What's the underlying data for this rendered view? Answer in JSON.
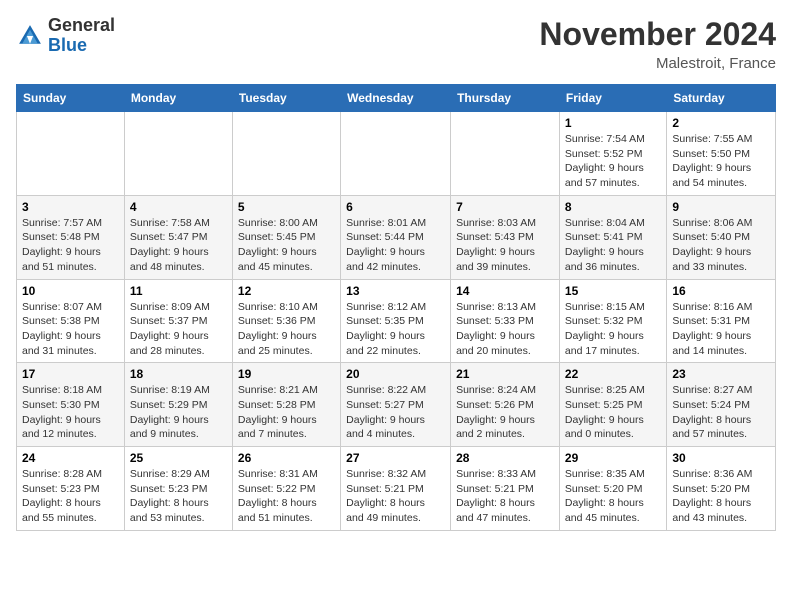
{
  "logo": {
    "text_general": "General",
    "text_blue": "Blue"
  },
  "header": {
    "month": "November 2024",
    "location": "Malestroit, France"
  },
  "weekdays": [
    "Sunday",
    "Monday",
    "Tuesday",
    "Wednesday",
    "Thursday",
    "Friday",
    "Saturday"
  ],
  "weeks": [
    [
      {
        "day": "",
        "info": ""
      },
      {
        "day": "",
        "info": ""
      },
      {
        "day": "",
        "info": ""
      },
      {
        "day": "",
        "info": ""
      },
      {
        "day": "",
        "info": ""
      },
      {
        "day": "1",
        "info": "Sunrise: 7:54 AM\nSunset: 5:52 PM\nDaylight: 9 hours and 57 minutes."
      },
      {
        "day": "2",
        "info": "Sunrise: 7:55 AM\nSunset: 5:50 PM\nDaylight: 9 hours and 54 minutes."
      }
    ],
    [
      {
        "day": "3",
        "info": "Sunrise: 7:57 AM\nSunset: 5:48 PM\nDaylight: 9 hours and 51 minutes."
      },
      {
        "day": "4",
        "info": "Sunrise: 7:58 AM\nSunset: 5:47 PM\nDaylight: 9 hours and 48 minutes."
      },
      {
        "day": "5",
        "info": "Sunrise: 8:00 AM\nSunset: 5:45 PM\nDaylight: 9 hours and 45 minutes."
      },
      {
        "day": "6",
        "info": "Sunrise: 8:01 AM\nSunset: 5:44 PM\nDaylight: 9 hours and 42 minutes."
      },
      {
        "day": "7",
        "info": "Sunrise: 8:03 AM\nSunset: 5:43 PM\nDaylight: 9 hours and 39 minutes."
      },
      {
        "day": "8",
        "info": "Sunrise: 8:04 AM\nSunset: 5:41 PM\nDaylight: 9 hours and 36 minutes."
      },
      {
        "day": "9",
        "info": "Sunrise: 8:06 AM\nSunset: 5:40 PM\nDaylight: 9 hours and 33 minutes."
      }
    ],
    [
      {
        "day": "10",
        "info": "Sunrise: 8:07 AM\nSunset: 5:38 PM\nDaylight: 9 hours and 31 minutes."
      },
      {
        "day": "11",
        "info": "Sunrise: 8:09 AM\nSunset: 5:37 PM\nDaylight: 9 hours and 28 minutes."
      },
      {
        "day": "12",
        "info": "Sunrise: 8:10 AM\nSunset: 5:36 PM\nDaylight: 9 hours and 25 minutes."
      },
      {
        "day": "13",
        "info": "Sunrise: 8:12 AM\nSunset: 5:35 PM\nDaylight: 9 hours and 22 minutes."
      },
      {
        "day": "14",
        "info": "Sunrise: 8:13 AM\nSunset: 5:33 PM\nDaylight: 9 hours and 20 minutes."
      },
      {
        "day": "15",
        "info": "Sunrise: 8:15 AM\nSunset: 5:32 PM\nDaylight: 9 hours and 17 minutes."
      },
      {
        "day": "16",
        "info": "Sunrise: 8:16 AM\nSunset: 5:31 PM\nDaylight: 9 hours and 14 minutes."
      }
    ],
    [
      {
        "day": "17",
        "info": "Sunrise: 8:18 AM\nSunset: 5:30 PM\nDaylight: 9 hours and 12 minutes."
      },
      {
        "day": "18",
        "info": "Sunrise: 8:19 AM\nSunset: 5:29 PM\nDaylight: 9 hours and 9 minutes."
      },
      {
        "day": "19",
        "info": "Sunrise: 8:21 AM\nSunset: 5:28 PM\nDaylight: 9 hours and 7 minutes."
      },
      {
        "day": "20",
        "info": "Sunrise: 8:22 AM\nSunset: 5:27 PM\nDaylight: 9 hours and 4 minutes."
      },
      {
        "day": "21",
        "info": "Sunrise: 8:24 AM\nSunset: 5:26 PM\nDaylight: 9 hours and 2 minutes."
      },
      {
        "day": "22",
        "info": "Sunrise: 8:25 AM\nSunset: 5:25 PM\nDaylight: 9 hours and 0 minutes."
      },
      {
        "day": "23",
        "info": "Sunrise: 8:27 AM\nSunset: 5:24 PM\nDaylight: 8 hours and 57 minutes."
      }
    ],
    [
      {
        "day": "24",
        "info": "Sunrise: 8:28 AM\nSunset: 5:23 PM\nDaylight: 8 hours and 55 minutes."
      },
      {
        "day": "25",
        "info": "Sunrise: 8:29 AM\nSunset: 5:23 PM\nDaylight: 8 hours and 53 minutes."
      },
      {
        "day": "26",
        "info": "Sunrise: 8:31 AM\nSunset: 5:22 PM\nDaylight: 8 hours and 51 minutes."
      },
      {
        "day": "27",
        "info": "Sunrise: 8:32 AM\nSunset: 5:21 PM\nDaylight: 8 hours and 49 minutes."
      },
      {
        "day": "28",
        "info": "Sunrise: 8:33 AM\nSunset: 5:21 PM\nDaylight: 8 hours and 47 minutes."
      },
      {
        "day": "29",
        "info": "Sunrise: 8:35 AM\nSunset: 5:20 PM\nDaylight: 8 hours and 45 minutes."
      },
      {
        "day": "30",
        "info": "Sunrise: 8:36 AM\nSunset: 5:20 PM\nDaylight: 8 hours and 43 minutes."
      }
    ]
  ]
}
